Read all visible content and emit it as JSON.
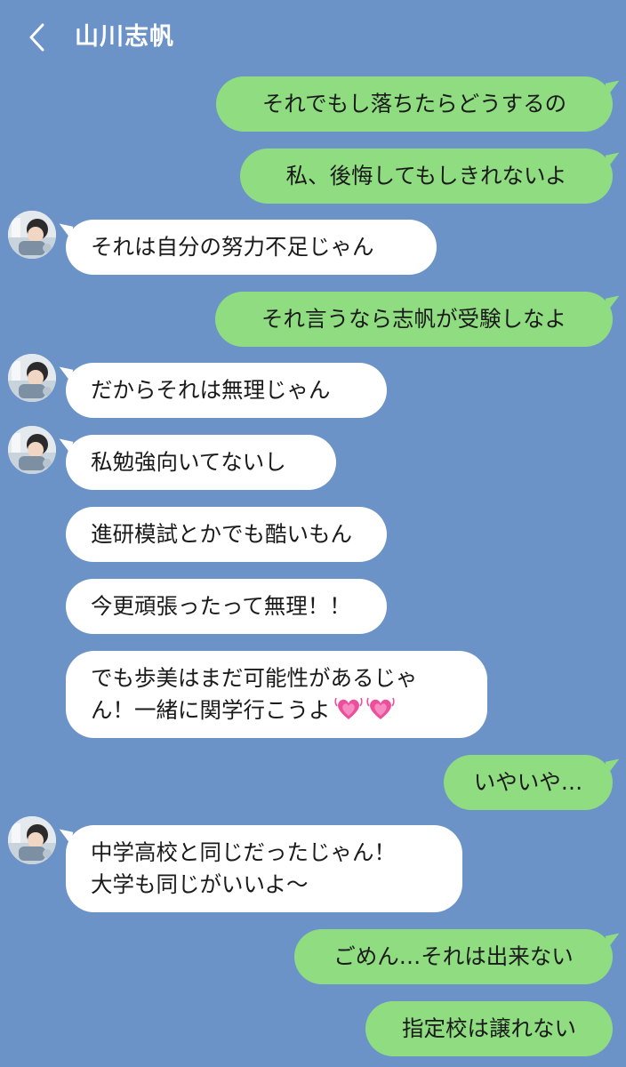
{
  "header": {
    "contact_name": "山川志帆",
    "back_icon": "chevron-left-icon"
  },
  "colors": {
    "background": "#6b93c8",
    "sent_bubble": "#8fdd80",
    "received_bubble": "#ffffff",
    "heart": "#ec4f9c"
  },
  "messages": [
    {
      "side": "sent",
      "text": "それでもし落ちたらどうするの"
    },
    {
      "side": "sent",
      "text": "私、後悔してもしきれないよ"
    },
    {
      "side": "received",
      "text": "それは自分の努力不足じゃん"
    },
    {
      "side": "sent",
      "text": "それ言うなら志帆が受験しなよ"
    },
    {
      "side": "received",
      "text": "だからそれは無理じゃん"
    },
    {
      "side": "received",
      "text": "私勉強向いてないし"
    },
    {
      "side": "received",
      "text": "進研模試とかでも酷いもん"
    },
    {
      "side": "received",
      "text": "今更頑張ったって無理！！"
    },
    {
      "side": "received",
      "line1": "でも歩美はまだ可能性があるじゃ",
      "line2": "ん！一緒に関学行こうよ",
      "emoji": "growing-heart-icon"
    },
    {
      "side": "sent",
      "text": "いやいや…"
    },
    {
      "side": "received",
      "line1": "中学高校と同じだったじゃん！",
      "line2": "大学も同じがいいよ〜"
    },
    {
      "side": "sent",
      "text": "ごめん…それは出来ない"
    },
    {
      "side": "sent",
      "text": "指定校は譲れない"
    }
  ]
}
